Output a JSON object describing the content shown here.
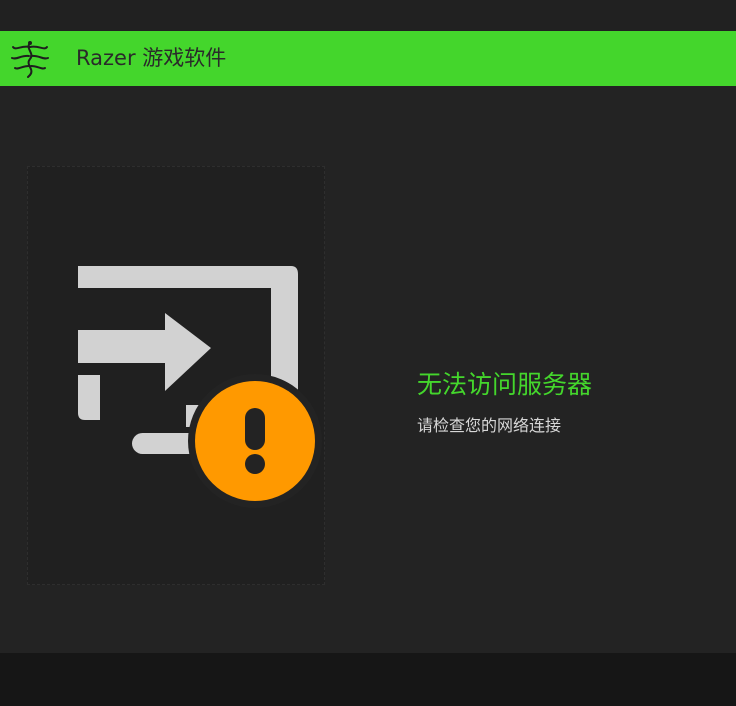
{
  "app": {
    "title": "Razer 游戏软件",
    "logo_icon": "razer-snake-logo",
    "accent_color": "#44d62c"
  },
  "error": {
    "title": "无法访问服务器",
    "message": "请检查您的网络连接",
    "illustration_icon": "screen-login-arrow-with-warning-icon",
    "warning_color": "#ff9900"
  }
}
